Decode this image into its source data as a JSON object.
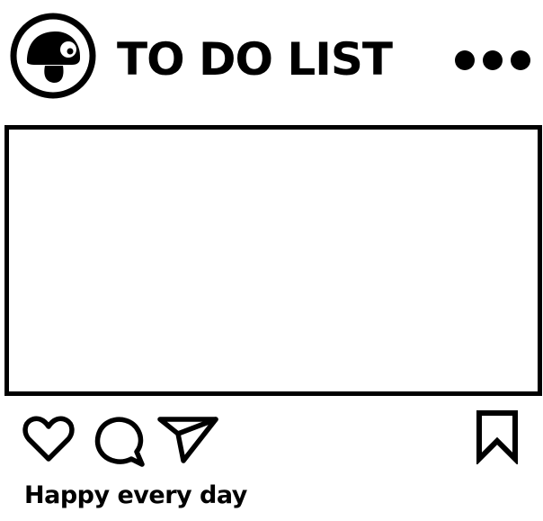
{
  "header": {
    "title": "TO DO LIST",
    "avatar_icon": "mushroom-icon",
    "more_icon": "more-options-icon"
  },
  "post": {
    "image_icon": "empty-photo-frame"
  },
  "actions": {
    "like_icon": "heart-icon",
    "comment_icon": "comment-bubble-icon",
    "share_icon": "paper-plane-icon",
    "save_icon": "bookmark-icon"
  },
  "caption": {
    "text": "Happy every day"
  },
  "colors": {
    "ink": "#000000",
    "background": "#ffffff"
  }
}
